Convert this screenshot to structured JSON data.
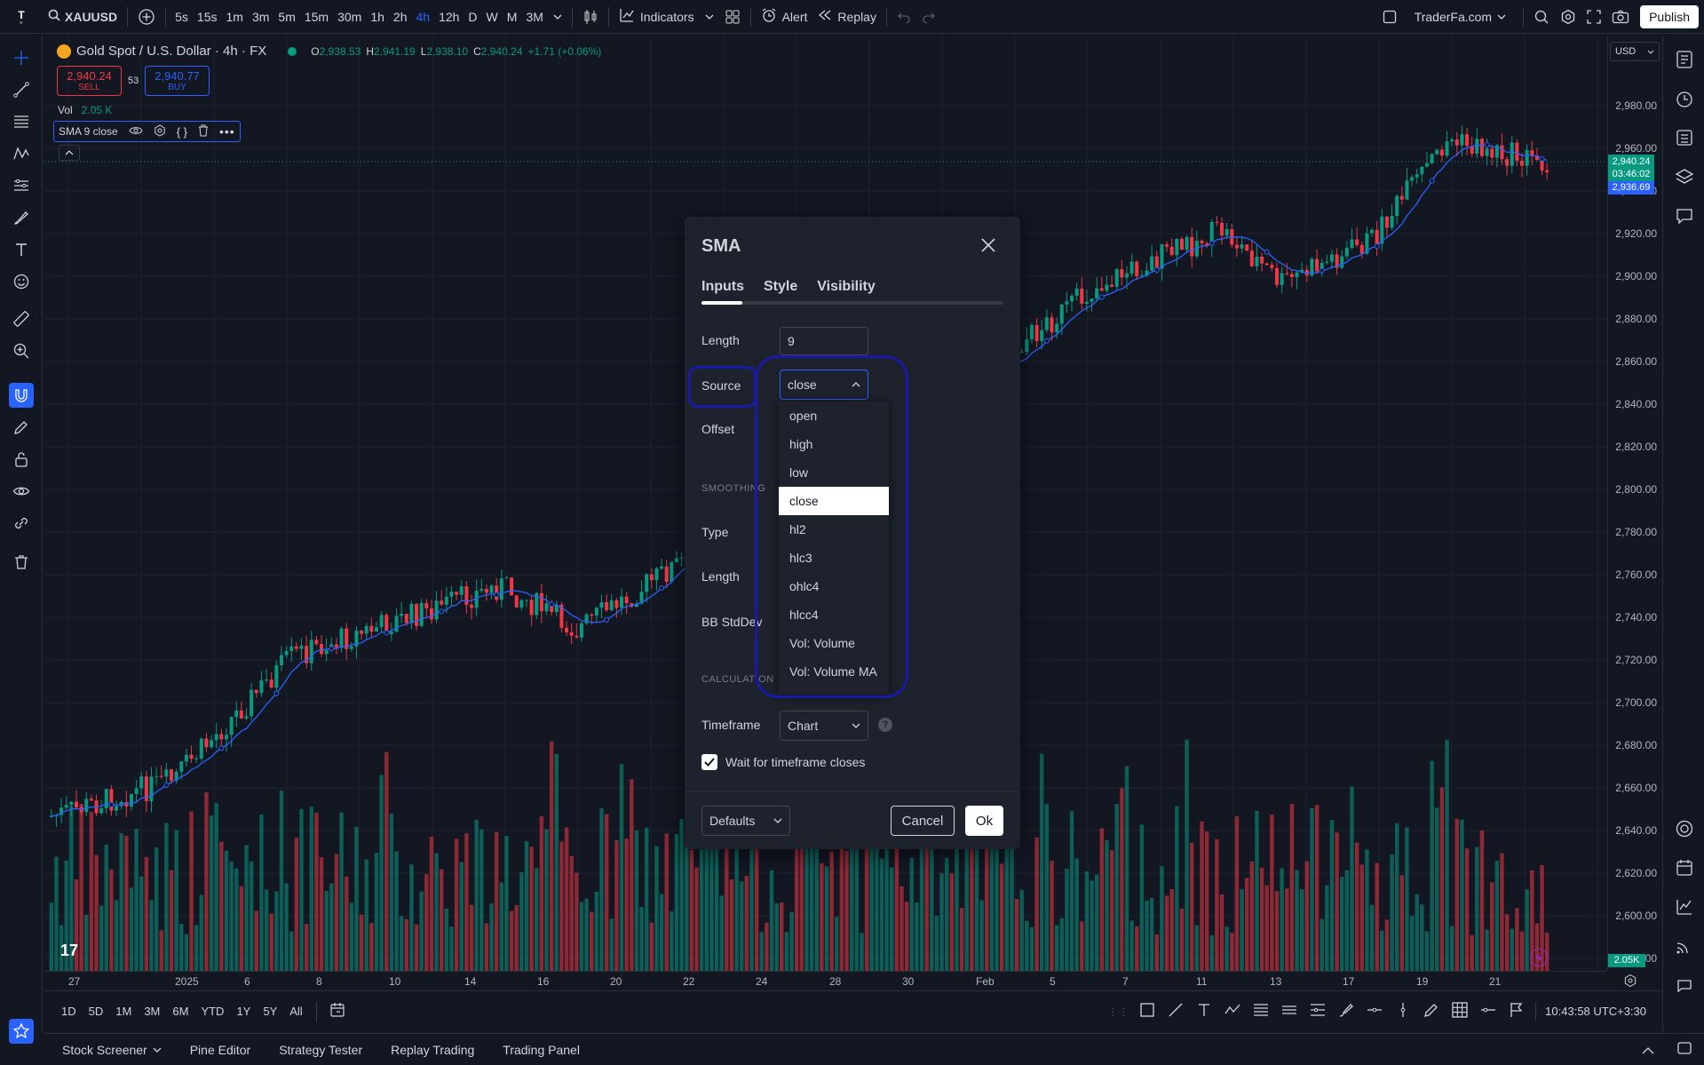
{
  "topbar": {
    "symbol": "XAUUSD",
    "intervals": [
      "5s",
      "15s",
      "1m",
      "3m",
      "5m",
      "15m",
      "30m",
      "1h",
      "2h",
      "4h",
      "12h",
      "D",
      "W",
      "M",
      "3M"
    ],
    "active_interval": "4h",
    "indicators_label": "Indicators",
    "alert_label": "Alert",
    "replay_label": "Replay",
    "account_label": "TraderFa.com",
    "publish_label": "Publish"
  },
  "legend": {
    "title": "Gold Spot / U.S. Dollar · 4h · FX",
    "o_label": "O",
    "o_value": "2,938.53",
    "h_label": "H",
    "h_value": "2,941.19",
    "l_label": "L",
    "l_value": "2,938.10",
    "c_label": "C",
    "c_value": "2,940.24",
    "change": "+1.71 (+0.06%)",
    "sell_price": "2,940.24",
    "sell_label": "SELL",
    "spread": "53",
    "buy_price": "2,940.77",
    "buy_label": "BUY",
    "vol_label": "Vol",
    "vol_value": "2.05 K",
    "sma_label": "SMA 9 close"
  },
  "price_scale": {
    "currency": "USD",
    "labels": [
      "2,980.00",
      "2,960.00",
      "2,940.00",
      "2,920.00",
      "2,900.00",
      "2,880.00",
      "2,860.00",
      "2,840.00",
      "2,820.00",
      "2,800.00",
      "2,780.00",
      "2,760.00",
      "2,740.00",
      "2,720.00",
      "2,700.00",
      "2,680.00",
      "2,660.00",
      "2,640.00",
      "2,620.00",
      "2,600.00",
      "2,580.00"
    ],
    "last_price": "2,940.24",
    "countdown": "03:46:02",
    "sma_price": "2,936.69",
    "vol_badge": "2.05K"
  },
  "time_scale": {
    "labels": [
      "27",
      "2025",
      "6",
      "8",
      "10",
      "14",
      "16",
      "20",
      "22",
      "24",
      "28",
      "30",
      "Feb",
      "5",
      "7",
      "11",
      "13",
      "17",
      "19",
      "21"
    ]
  },
  "bottombar": {
    "ranges": [
      "1D",
      "5D",
      "1M",
      "3M",
      "6M",
      "YTD",
      "1Y",
      "5Y",
      "All"
    ],
    "clock": "10:43:58 UTC+3:30"
  },
  "panels": {
    "items": [
      "Stock Screener",
      "Pine Editor",
      "Strategy Tester",
      "Replay Trading",
      "Trading Panel"
    ]
  },
  "dialog": {
    "title": "SMA",
    "tabs": [
      "Inputs",
      "Style",
      "Visibility"
    ],
    "active_tab": "Inputs",
    "length_label": "Length",
    "length_value": "9",
    "source_label": "Source",
    "source_value": "close",
    "offset_label": "Offset",
    "smoothing_section": "SMOOTHING",
    "type_label": "Type",
    "length2_label": "Length",
    "bb_label": "BB StdDev",
    "calculation_section": "CALCULATION",
    "timeframe_label": "Timeframe",
    "timeframe_value": "Chart",
    "wait_label": "Wait for timeframe closes",
    "wait_checked": true,
    "defaults_label": "Defaults",
    "cancel_label": "Cancel",
    "ok_label": "Ok"
  },
  "dropdown": {
    "options": [
      "open",
      "high",
      "low",
      "close",
      "hl2",
      "hlc3",
      "ohlc4",
      "hlcc4",
      "Vol: Volume",
      "Vol: Volume MA"
    ],
    "selected": "close"
  },
  "colors": {
    "up": "#089981",
    "down": "#f23645",
    "sma": "#2962ff",
    "highlight": "#1a1aa8"
  }
}
